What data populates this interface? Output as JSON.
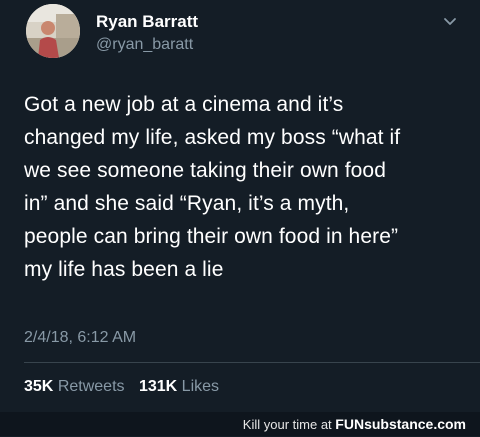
{
  "tweet": {
    "display_name": "Ryan Barratt",
    "handle": "@ryan_baratt",
    "text_lines": [
      "Got a new job at a cinema and it’s",
      "changed my life, asked my boss “what if",
      "we see someone taking their own food",
      "in” and she said “Ryan, it’s a myth,",
      "people can bring their own food in here”",
      "my life has been a lie"
    ],
    "timestamp": "2/4/18, 6:12 AM",
    "retweets_count": "35K",
    "retweets_label": "Retweets",
    "likes_count": "131K",
    "likes_label": "Likes",
    "menu_icon": "chevron-down-icon"
  },
  "watermark": {
    "prefix": "Kill your time at",
    "brand": "FUNsubstance.com"
  },
  "colors": {
    "background": "#141d26",
    "secondary_text": "#8899a6",
    "primary_text": "#ffffff"
  }
}
